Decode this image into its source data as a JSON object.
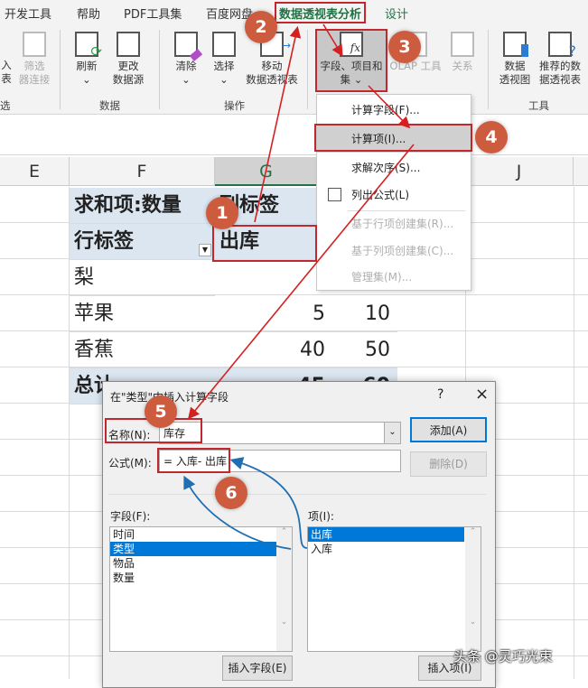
{
  "tabs": [
    "开发工具",
    "帮助",
    "PDF工具集",
    "百度网盘",
    "数据透视表分析",
    "设计"
  ],
  "ribbon": {
    "partial_left": [
      "入",
      "表",
      "选"
    ],
    "filter_conn": [
      "筛选",
      "器连接"
    ],
    "refresh": "刷新",
    "change_src": [
      "更改",
      "数据源"
    ],
    "clear": "清除",
    "select": "选择",
    "move": [
      "移动",
      "数据透视表"
    ],
    "fields": [
      "字段、项目和",
      "集"
    ],
    "olap": "OLAP 工具",
    "relations": "关系",
    "pivotchart": [
      "数据",
      "透视图"
    ],
    "recommended": [
      "推荐的数",
      "据透视表"
    ],
    "groups": {
      "data": "数据",
      "ops": "操作",
      "tools": "工具"
    }
  },
  "columns": [
    "E",
    "F",
    "G",
    "J"
  ],
  "pivot": {
    "sum_label": "求和项:数量",
    "col_label": "列标签",
    "row_label": "行标签",
    "col_item": "出库",
    "rows": [
      {
        "name": "梨",
        "v1": "",
        "v2": ""
      },
      {
        "name": "苹果",
        "v1": "5",
        "v2": "10"
      },
      {
        "name": "香蕉",
        "v1": "40",
        "v2": "50"
      }
    ],
    "total": {
      "name": "总计",
      "v1": "45",
      "v2": "60"
    }
  },
  "menu": {
    "items": [
      "计算字段(F)...",
      "计算项(I)...",
      "求解次序(S)...",
      "列出公式(L)",
      "基于行项创建集(R)...",
      "基于列项创建集(C)...",
      "管理集(M)..."
    ]
  },
  "dialog": {
    "title": "在\"类型\"中插入计算字段",
    "help": "?",
    "close": "×",
    "name_label": "名称(N):",
    "name_value": "库存",
    "formula_label": "公式(M):",
    "formula_value": "= 入库- 出库",
    "add": "添加(A)",
    "delete": "删除(D)",
    "fields_label": "字段(F):",
    "fields": [
      "时间",
      "类型",
      "物品",
      "数量"
    ],
    "items_label": "项(I):",
    "items": [
      "出库",
      "入库"
    ],
    "insert_field": "插入字段(E)",
    "insert_item": "插入项(I)"
  },
  "steps": [
    "1",
    "2",
    "3",
    "4",
    "5",
    "6"
  ],
  "watermark": "头条 @灵巧光束"
}
